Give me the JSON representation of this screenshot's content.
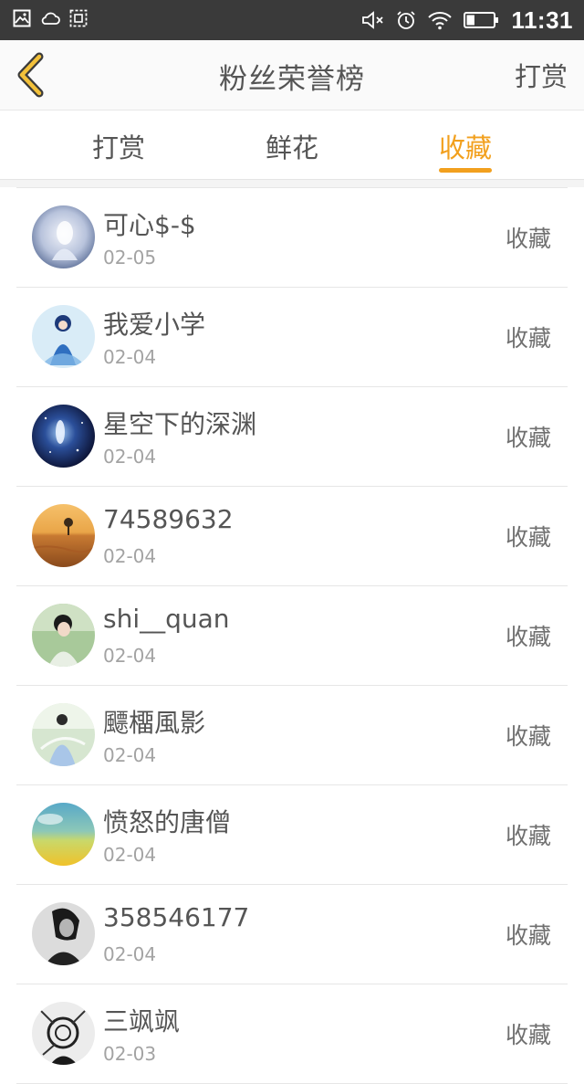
{
  "status_bar": {
    "time": "11:31",
    "left_icons": [
      "image-icon",
      "cloud-icon",
      "screenshot-icon"
    ],
    "right_icons": [
      "mute-icon",
      "alarm-icon",
      "wifi-icon",
      "battery-icon"
    ],
    "battery_level": 0.3
  },
  "header": {
    "back_icon": "chevron-left-icon",
    "title": "粉丝荣誉榜",
    "action_label": "打赏"
  },
  "tabs": [
    {
      "label": "打赏",
      "active": false
    },
    {
      "label": "鲜花",
      "active": false
    },
    {
      "label": "收藏",
      "active": true
    }
  ],
  "colors": {
    "accent": "#f2a01e",
    "status_bar_bg": "#3a3a3a",
    "text_primary": "#555555",
    "text_secondary": "#a3a3a3"
  },
  "list": [
    {
      "name": "可心$-$",
      "date": "02-05",
      "action": "收藏",
      "avatar": "avatar-icon"
    },
    {
      "name": "我爱小学",
      "date": "02-04",
      "action": "收藏",
      "avatar": "avatar-icon"
    },
    {
      "name": "星空下的深渊",
      "date": "02-04",
      "action": "收藏",
      "avatar": "avatar-icon"
    },
    {
      "name": "74589632",
      "date": "02-04",
      "action": "收藏",
      "avatar": "avatar-icon"
    },
    {
      "name": "shi__quan",
      "date": "02-04",
      "action": "收藏",
      "avatar": "avatar-icon"
    },
    {
      "name": "飃橊風影",
      "date": "02-04",
      "action": "收藏",
      "avatar": "avatar-icon"
    },
    {
      "name": "愤怒的唐僧",
      "date": "02-04",
      "action": "收藏",
      "avatar": "avatar-icon"
    },
    {
      "name": "358546177",
      "date": "02-04",
      "action": "收藏",
      "avatar": "avatar-icon"
    },
    {
      "name": "三飒飒",
      "date": "02-03",
      "action": "收藏",
      "avatar": "avatar-icon"
    }
  ]
}
